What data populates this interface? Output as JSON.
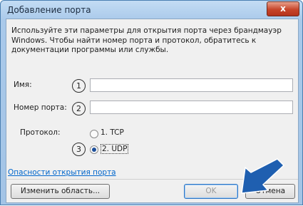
{
  "window": {
    "title": "Добавление порта",
    "close_label": "x"
  },
  "description": "Используйте эти параметры для открытия порта через брандмауэр Windows. Чтобы найти номер порта и протокол, обратитесь к документации программы или службы.",
  "fields": {
    "name_label": "Имя:",
    "name_value": "",
    "port_label": "Номер порта:",
    "port_value": "",
    "protocol_label": "Протокол:"
  },
  "markers": [
    "1",
    "2",
    "3"
  ],
  "protocol_options": [
    {
      "label": "1. TCP",
      "selected": false
    },
    {
      "label": "2. UDP",
      "selected": true
    }
  ],
  "link_text": "Опасности открытия порта",
  "buttons": {
    "change_scope": "Изменить область...",
    "ok": "OK",
    "cancel": "Отмена"
  },
  "colors": {
    "annotation_arrow": "#1f5fb0",
    "link": "#0066cc"
  }
}
